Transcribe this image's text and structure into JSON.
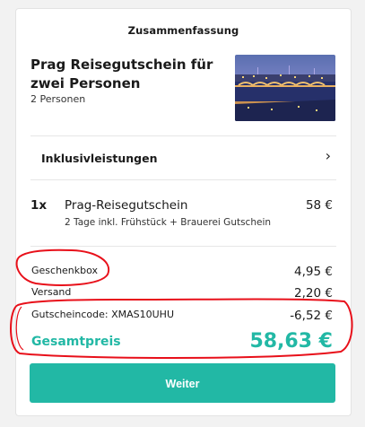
{
  "summary_title": "Zusammenfassung",
  "product": {
    "title": "Prag Reisegutschein für zwei Personen",
    "subtitle": "2 Personen"
  },
  "inclusions_label": "Inklusivleistungen",
  "item": {
    "qty": "1x",
    "name": "Prag-Reisegutschein",
    "price": "58 €",
    "description": "2 Tage inkl. Frühstück + Brauerei Gutschein"
  },
  "lines": [
    {
      "label": "Geschenkbox",
      "value": "4,95 €"
    },
    {
      "label": "Versand",
      "value": "2,20 €"
    },
    {
      "label": "Gutscheincode: XMAS10UHU",
      "value": "-6,52 €"
    }
  ],
  "total": {
    "label": "Gesamtpreis",
    "value": "58,63 €"
  },
  "button_label": "Weiter",
  "colors": {
    "accent": "#22b8a5",
    "annotation": "#e8101a"
  },
  "icons": {
    "chevron": "chevron-right-icon"
  }
}
